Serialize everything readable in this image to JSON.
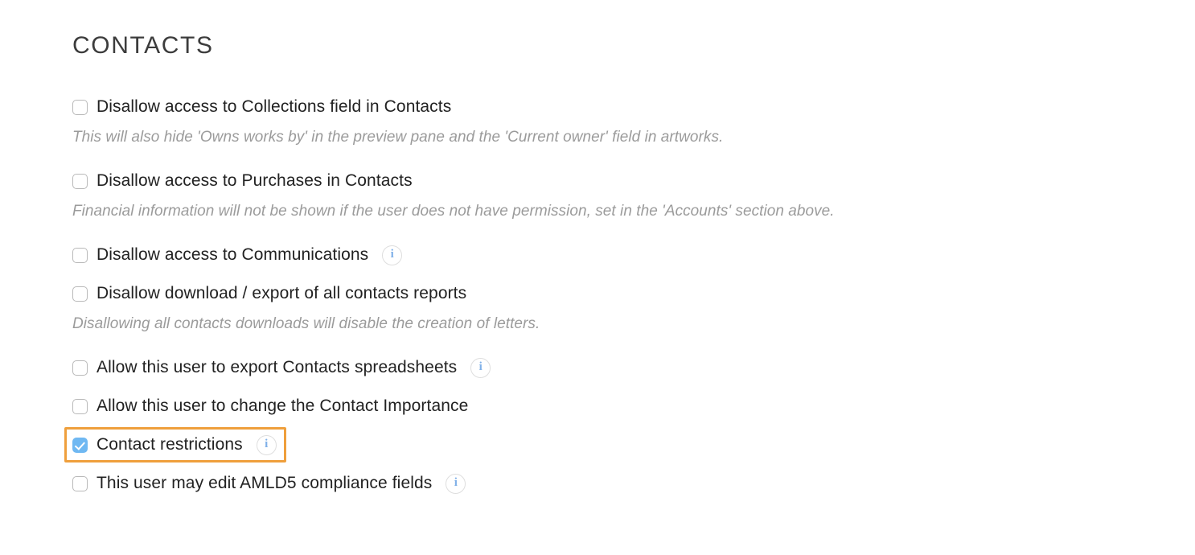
{
  "section": {
    "title": "CONTACTS"
  },
  "colors": {
    "checkbox_checked": "#6fb8f2",
    "checkbox_border": "#b9b9b9",
    "highlight_border": "#ef9f3c",
    "label_text": "#222222",
    "helper_text": "#9b9b9b",
    "title_text": "#3c3c3c",
    "info_icon_glyph": "#7fb0e8"
  },
  "icons": {
    "info": "i",
    "info_name": "info-icon",
    "checkmark_name": "checkmark-icon"
  },
  "options": [
    {
      "id": "disallow-collections-field",
      "label": "Disallow access to Collections field in Contacts",
      "checked": false,
      "info": false,
      "helper": "This will also hide 'Owns works by' in the preview pane and the 'Current owner' field in artworks.",
      "highlighted": false
    },
    {
      "id": "disallow-purchases",
      "label": "Disallow access to Purchases in Contacts",
      "checked": false,
      "info": false,
      "helper": "Financial information will not be shown if the user does not have permission, set in the 'Accounts' section above.",
      "highlighted": false
    },
    {
      "id": "disallow-communications",
      "label": "Disallow access to Communications",
      "checked": false,
      "info": true,
      "helper": null,
      "highlighted": false
    },
    {
      "id": "disallow-download-export-reports",
      "label": "Disallow download / export of all contacts reports",
      "checked": false,
      "info": false,
      "helper": "Disallowing all contacts downloads will disable the creation of letters.",
      "highlighted": false
    },
    {
      "id": "allow-export-spreadsheets",
      "label": "Allow this user to export Contacts spreadsheets",
      "checked": false,
      "info": true,
      "helper": null,
      "highlighted": false
    },
    {
      "id": "allow-change-contact-importance",
      "label": "Allow this user to change the Contact Importance",
      "checked": false,
      "info": false,
      "helper": null,
      "highlighted": false
    },
    {
      "id": "contact-restrictions",
      "label": "Contact restrictions",
      "checked": true,
      "info": true,
      "helper": null,
      "highlighted": true
    },
    {
      "id": "edit-amld5-compliance-fields",
      "label": "This user may edit AMLD5 compliance fields",
      "checked": false,
      "info": true,
      "helper": null,
      "highlighted": false
    }
  ]
}
